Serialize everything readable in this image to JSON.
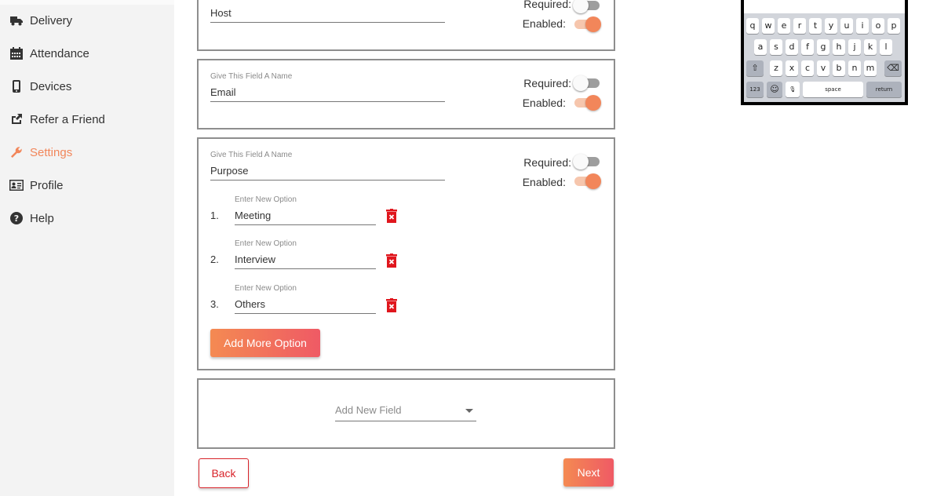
{
  "sidebar": {
    "items": [
      {
        "label": "Delivery",
        "icon": "truck-icon"
      },
      {
        "label": "Attendance",
        "icon": "calendar-icon"
      },
      {
        "label": "Devices",
        "icon": "phone-icon"
      },
      {
        "label": "Refer a Friend",
        "icon": "share-icon"
      },
      {
        "label": "Settings",
        "icon": "wrench-icon",
        "active": true
      },
      {
        "label": "Profile",
        "icon": "id-card-icon"
      },
      {
        "label": "Help",
        "icon": "question-circle-icon"
      }
    ]
  },
  "fields": [
    {
      "value": "Host",
      "required_label": "Required:",
      "enabled_label": "Enabled:",
      "required": false,
      "enabled": true
    },
    {
      "name_label": "Give This Field A Name",
      "value": "Email",
      "required_label": "Required:",
      "enabled_label": "Enabled:",
      "required": false,
      "enabled": true
    },
    {
      "name_label": "Give This Field A Name",
      "value": "Purpose",
      "required_label": "Required:",
      "enabled_label": "Enabled:",
      "required": false,
      "enabled": true,
      "options": [
        {
          "num": "1.",
          "label": "Enter New Option",
          "value": "Meeting"
        },
        {
          "num": "2.",
          "label": "Enter New Option",
          "value": "Interview"
        },
        {
          "num": "3.",
          "label": "Enter New Option",
          "value": "Others"
        }
      ],
      "add_option_label": "Add More Option"
    }
  ],
  "add_field": {
    "placeholder": "Add New Field"
  },
  "actions": {
    "back": "Back",
    "next": "Next"
  },
  "keyboard": {
    "row1": [
      "q",
      "w",
      "e",
      "r",
      "t",
      "y",
      "u",
      "i",
      "o",
      "p"
    ],
    "row2": [
      "a",
      "s",
      "d",
      "f",
      "g",
      "h",
      "j",
      "k",
      "l"
    ],
    "row3": [
      "z",
      "x",
      "c",
      "v",
      "b",
      "n",
      "m"
    ],
    "shift": "⇧",
    "backspace": "⌫",
    "numbers": "123",
    "emoji": "☺",
    "mic": "🎙",
    "space": "space",
    "return": "return"
  },
  "colors": {
    "accent": "#f2865a",
    "danger": "#d8232a",
    "gradient_start": "#f48a52",
    "gradient_end": "#ef5a65"
  }
}
